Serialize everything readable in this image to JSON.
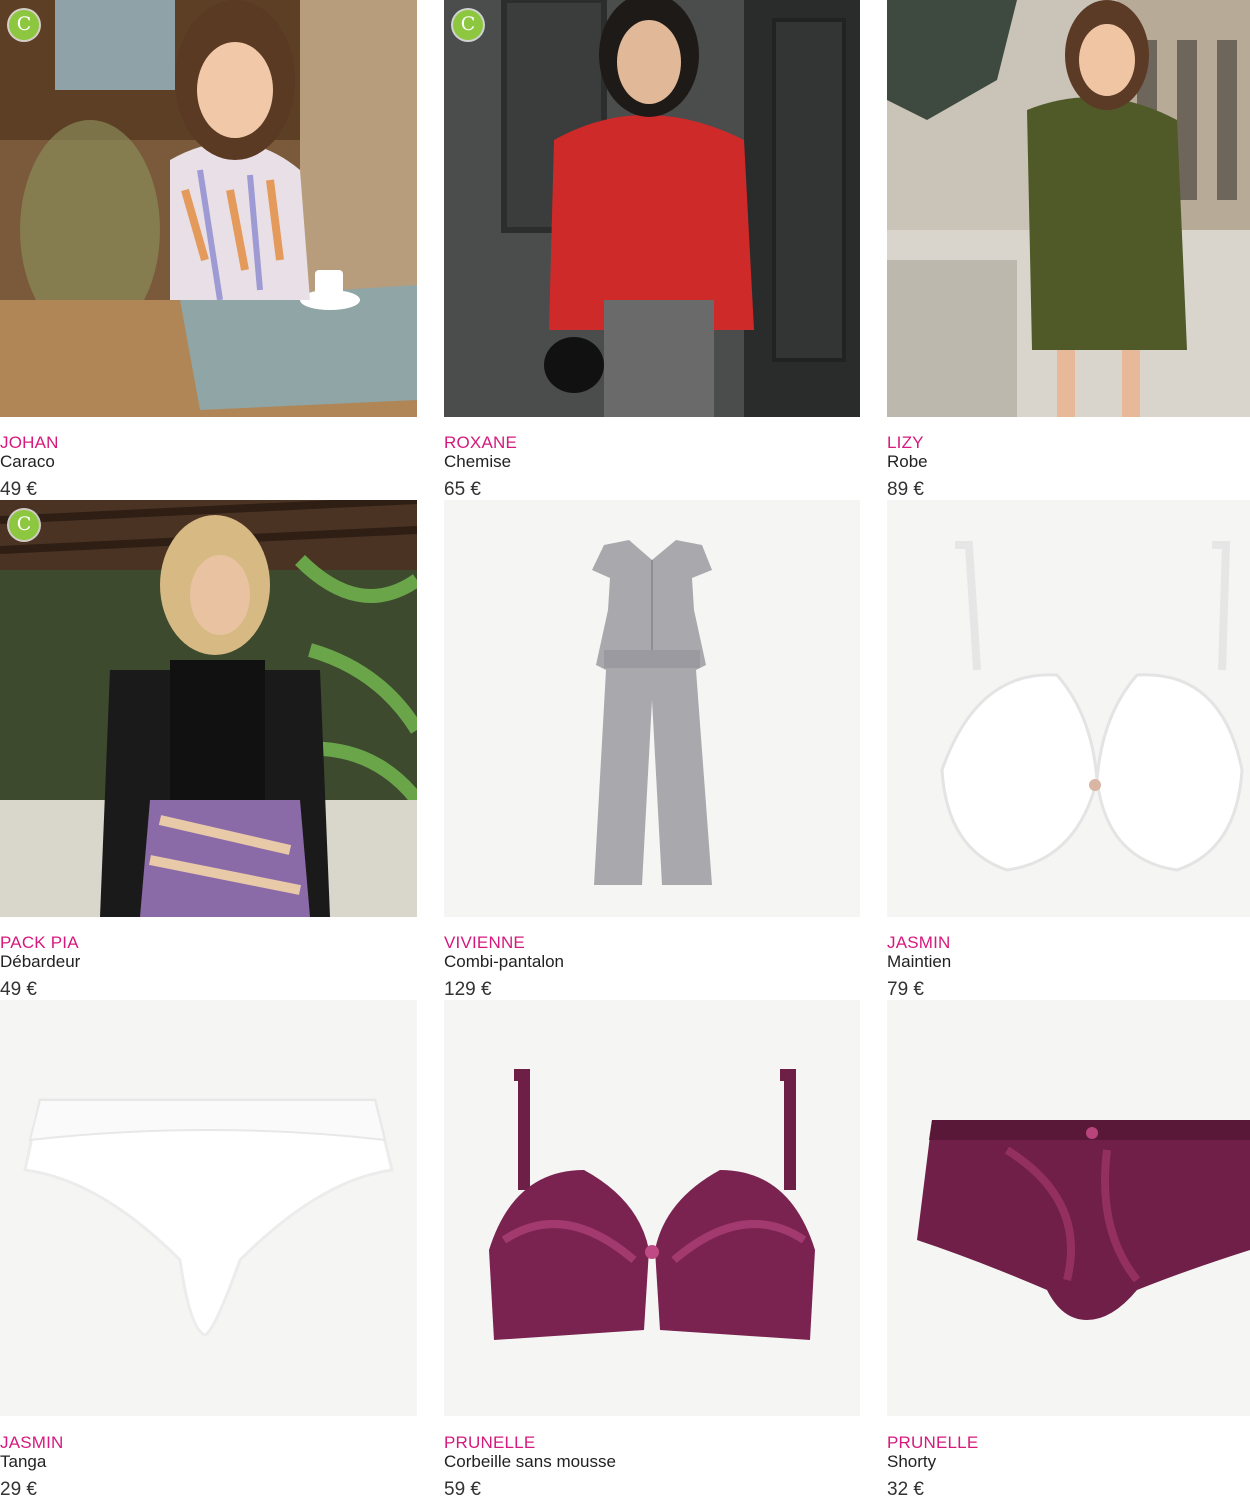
{
  "products": [
    {
      "brand": "JOHAN",
      "type": "Caraco",
      "price": "49 €",
      "eco_badge": true,
      "badge_icon": "C"
    },
    {
      "brand": "ROXANE",
      "type": "Chemise",
      "price": "65 €",
      "eco_badge": true,
      "badge_icon": "C"
    },
    {
      "brand": "LIZY",
      "type": "Robe",
      "price": "89 €",
      "eco_badge": false
    },
    {
      "brand": "PACK PIA",
      "type": "Débardeur",
      "price": "49 €",
      "eco_badge": true,
      "badge_icon": "C"
    },
    {
      "brand": "VIVIENNE",
      "type": "Combi-pantalon",
      "price": "129 €",
      "eco_badge": false
    },
    {
      "brand": "JASMIN",
      "type": "Maintien",
      "price": "79 €",
      "eco_badge": false
    },
    {
      "brand": "JASMIN",
      "type": "Tanga",
      "price": "29 €",
      "eco_badge": false
    },
    {
      "brand": "PRUNELLE",
      "type": "Corbeille sans mousse",
      "price": "59 €",
      "eco_badge": false
    },
    {
      "brand": "PRUNELLE",
      "type": "Shorty",
      "price": "32 €",
      "eco_badge": false
    }
  ],
  "colors": {
    "brand_pink": "#d6197c",
    "eco_badge_green": "#8dc63f",
    "text_dark": "#222222",
    "product_bg": "#f5f5f4"
  }
}
